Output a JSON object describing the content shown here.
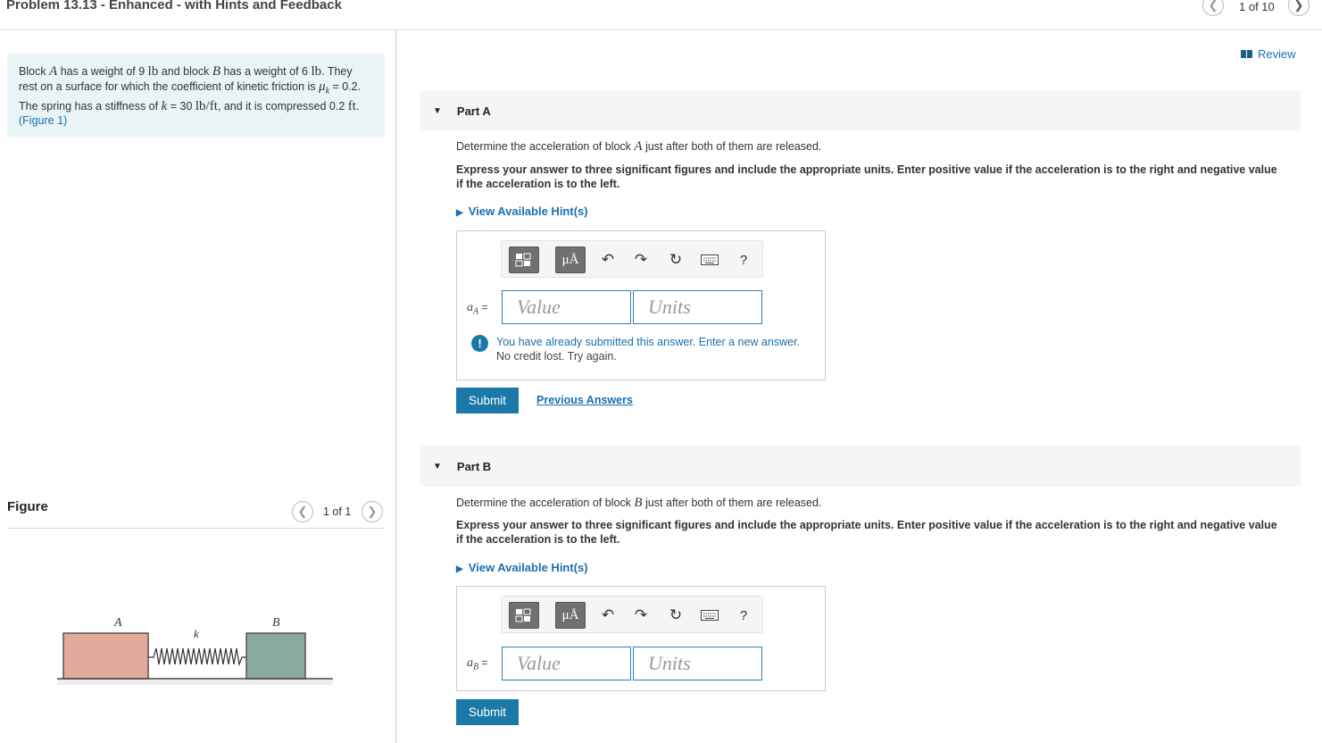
{
  "header": {
    "title": "Problem 13.13 - Enhanced - with Hints and Feedback",
    "pager": "1 of 10"
  },
  "problem": {
    "t1": "Block ",
    "sA": "A",
    "t2": " has a weight of 9 ",
    "lb1": "lb",
    "t3": " and block ",
    "sB": "B",
    "t4": " has a weight of 6 ",
    "lb2": "lb",
    "t5": ". They rest on a surface for which the coefficient of kinetic friction is ",
    "mu": "μ",
    "musub": "k",
    "t6": " = 0.2. The spring has a stiffness of ",
    "k": "k",
    "t7": " = 30 ",
    "unit": "lb/ft",
    "t8": ", and it is compressed 0.2 ",
    "ft": "ft",
    "t9": ". ",
    "figlink": "(Figure 1)"
  },
  "figure": {
    "label": "Figure",
    "pager": "1 of 1",
    "labelA": "A",
    "labelB": "B",
    "labelK": "k",
    "colorA": "#e3a99a",
    "colorB": "#88ab9e"
  },
  "review": "Review",
  "partA": {
    "title": "Part A",
    "q1": "Determine the acceleration of block ",
    "qsym": "A",
    "q2": " just after both of them are released.",
    "instr": "Express your answer to three significant figures and include the appropriate units. Enter positive value if the acceleration is to the right and negative value if the acceleration is to the left.",
    "hint": "View Available Hint(s)",
    "lhs_var": "a",
    "lhs_sub": "A",
    "value_ph": "Value",
    "units_ph": "Units",
    "warn1": "You have already submitted this answer. Enter a new answer.",
    "warn2": "No credit lost. Try again.",
    "submit": "Submit",
    "prev": "Previous Answers"
  },
  "partB": {
    "title": "Part B",
    "q1": "Determine the acceleration of block ",
    "qsym": "B",
    "q2": " just after both of them are released.",
    "instr": "Express your answer to three significant figures and include the appropriate units. Enter positive value if the acceleration is to the right and negative value if the acceleration is to the left.",
    "hint": "View Available Hint(s)",
    "lhs_var": "a",
    "lhs_sub": "B",
    "value_ph": "Value",
    "units_ph": "Units",
    "submit": "Submit"
  },
  "toolbar": {
    "mu_label": "μÅ",
    "help": "?",
    "icons": [
      "templates-icon",
      "symbols-icon",
      "undo-icon",
      "redo-icon",
      "reset-icon",
      "keyboard-icon",
      "help-icon"
    ]
  }
}
